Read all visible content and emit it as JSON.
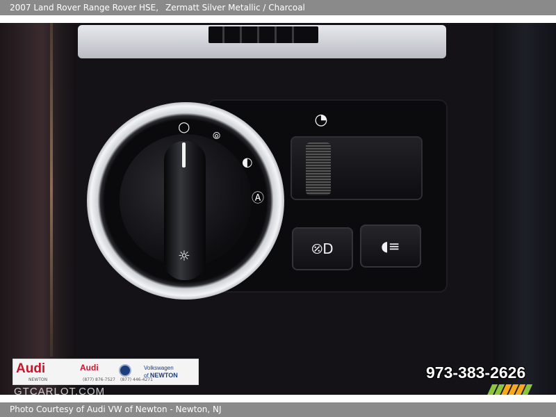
{
  "header": {
    "vehicle": "2007 Land Rover Range Rover HSE,",
    "color": "Zermatt Silver Metallic / Charcoal"
  },
  "photo": {
    "dealer_logo": {
      "audi_large": "Audi",
      "audi_large_sub": "NEWTON",
      "audi_small": "Audi",
      "phone_small_1": "(877) 876-7527",
      "phone_small_2": "(877) 446-4271",
      "vw_line1": "Volkswagen",
      "vw_line2_prefix": "of",
      "vw_line2": "NEWTON"
    },
    "watermark": "GTCARLOT.COM",
    "phone_overlay": "973-383-2626",
    "stripe_colors": [
      "#8bc53f",
      "#8bc53f",
      "#f7a81b",
      "#f7a81b",
      "#f7a81b",
      "#8bc53f"
    ]
  },
  "footer": {
    "credit": "Photo Courtesy of Audi VW of Newton - Newton, NJ"
  },
  "colors": {
    "bar": "#8a8a8a",
    "audi_red": "#c7152c",
    "vw_blue": "#1d3d7c"
  }
}
